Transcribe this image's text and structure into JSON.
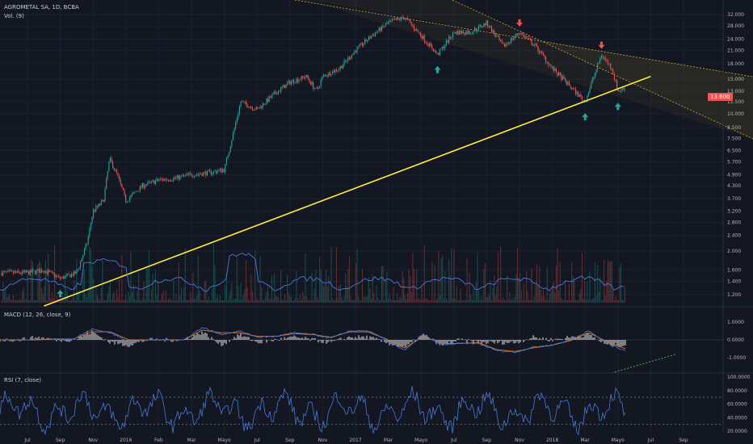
{
  "header": {
    "title": "AGROMETAL SA, 1D, BCBA",
    "volume_label": "Vol. (9)"
  },
  "panes": {
    "macd_label": "MACD (12, 26, close, 9)",
    "rsi_label": "RSI (7, close)"
  },
  "price_badge": "13.600",
  "colors": {
    "background": "#131722",
    "up": "#26a69a",
    "down": "#ef5350",
    "trendline": "#ffeb3b",
    "channel": "#c9b037",
    "indicator_blue": "#4a78d6",
    "indicator_orange": "#e0762a",
    "divergence": "#4caf50"
  },
  "chart_data": [
    {
      "type": "line",
      "name": "price",
      "scale": "log",
      "y_ticks": [
        "32.000",
        "28.000",
        "24.000",
        "21.000",
        "18.000",
        "15.000",
        "13.000",
        "11.500",
        "10.000",
        "8.500",
        "7.500",
        "6.500",
        "5.700",
        "4.900",
        "4.300",
        "3.700",
        "3.200",
        "2.800",
        "2.400",
        "2.000",
        "1.600",
        "1.400",
        "1.200"
      ],
      "x_ticks": [
        "Jul",
        "Sep",
        "Nov",
        "2016",
        "Feb",
        "Mar",
        "Mayo",
        "Jul",
        "Sep",
        "Nov",
        "2017",
        "Mar",
        "Mayo",
        "Jul",
        "Sep",
        "Nov",
        "2018",
        "Mar",
        "Mayo",
        "Jul",
        "Sep"
      ],
      "last_value": 13.6,
      "path": [
        {
          "x": "2015-07",
          "y": 1.55
        },
        {
          "x": "2015-08",
          "y": 1.6
        },
        {
          "x": "2015-09",
          "y": 1.45
        },
        {
          "x": "2015-10",
          "y": 1.55
        },
        {
          "x": "2015-10-20",
          "y": 2.2
        },
        {
          "x": "2015-11",
          "y": 3.2
        },
        {
          "x": "2015-11-20",
          "y": 3.6
        },
        {
          "x": "2015-12-01",
          "y": 5.9
        },
        {
          "x": "2015-12-15",
          "y": 4.9
        },
        {
          "x": "2016-01",
          "y": 3.6
        },
        {
          "x": "2016-02",
          "y": 4.3
        },
        {
          "x": "2016-03",
          "y": 4.6
        },
        {
          "x": "2016-04",
          "y": 4.7
        },
        {
          "x": "2016-05",
          "y": 4.9
        },
        {
          "x": "2016-06",
          "y": 5.0
        },
        {
          "x": "2016-07",
          "y": 5.2
        },
        {
          "x": "2016-07-15",
          "y": 7.5
        },
        {
          "x": "2016-08",
          "y": 11.5
        },
        {
          "x": "2016-09",
          "y": 10.5
        },
        {
          "x": "2016-10",
          "y": 12.5
        },
        {
          "x": "2016-11",
          "y": 14.5
        },
        {
          "x": "2016-12",
          "y": 15.5
        },
        {
          "x": "2016-12-20",
          "y": 13.0
        },
        {
          "x": "2017-01",
          "y": 15.5
        },
        {
          "x": "2017-02",
          "y": 17.0
        },
        {
          "x": "2017-03",
          "y": 21.0
        },
        {
          "x": "2017-04",
          "y": 25.0
        },
        {
          "x": "2017-05",
          "y": 29.0
        },
        {
          "x": "2017-06",
          "y": 31.0
        },
        {
          "x": "2017-07",
          "y": 25.0
        },
        {
          "x": "2017-08",
          "y": 20.0
        },
        {
          "x": "2017-09",
          "y": 26.0
        },
        {
          "x": "2017-10",
          "y": 26.0
        },
        {
          "x": "2017-11",
          "y": 29.0
        },
        {
          "x": "2017-12",
          "y": 22.0
        },
        {
          "x": "2018-01",
          "y": 26.0
        },
        {
          "x": "2018-02",
          "y": 22.0
        },
        {
          "x": "2018-03",
          "y": 17.0
        },
        {
          "x": "2018-04",
          "y": 14.0
        },
        {
          "x": "2018-05",
          "y": 11.5
        },
        {
          "x": "2018-05-15",
          "y": 15.0
        },
        {
          "x": "2018-06",
          "y": 20.0
        },
        {
          "x": "2018-06-20",
          "y": 17.0
        },
        {
          "x": "2018-07",
          "y": 13.0
        },
        {
          "x": "2018-07-15",
          "y": 13.6
        }
      ],
      "annotations": [
        {
          "type": "trendline",
          "from": {
            "x": "2015-08",
            "y": 1.05
          },
          "to": {
            "x": "2018-09",
            "y": 15.5
          }
        },
        {
          "type": "descending-channel"
        },
        {
          "type": "arrow-up",
          "x": "2015-09"
        },
        {
          "type": "arrow-up",
          "x": "2017-08"
        },
        {
          "type": "arrow-down",
          "x": "2018-01"
        },
        {
          "type": "arrow-up",
          "x": "2018-05"
        },
        {
          "type": "arrow-down",
          "x": "2018-06"
        },
        {
          "type": "arrow-up",
          "x": "2018-07"
        }
      ]
    },
    {
      "type": "line",
      "name": "MACD",
      "y_ticks": [
        "1.0000",
        "0.0000",
        "-1.0000"
      ],
      "macd": [
        0.0,
        0.0,
        0.05,
        0.05,
        0.05,
        0.6,
        0.4,
        -0.1,
        0.0,
        0.0,
        0.0,
        0.7,
        0.3,
        0.5,
        0.15,
        0.2,
        0.4,
        0.3,
        0.1,
        0.5,
        0.5,
        0.0,
        -0.6,
        0.3,
        -0.3,
        -0.2,
        -0.2,
        -0.6,
        -0.7,
        -0.4,
        -0.3,
        0.0,
        0.5,
        -0.2,
        -0.6
      ],
      "signal": [
        0.0,
        0.0,
        0.0,
        0.05,
        0.05,
        0.45,
        0.45,
        0.0,
        0.0,
        0.0,
        0.0,
        0.55,
        0.4,
        0.4,
        0.2,
        0.2,
        0.35,
        0.3,
        0.15,
        0.45,
        0.45,
        0.05,
        -0.45,
        0.2,
        -0.2,
        -0.2,
        -0.15,
        -0.55,
        -0.65,
        -0.45,
        -0.3,
        -0.05,
        0.4,
        -0.1,
        -0.5
      ]
    },
    {
      "type": "line",
      "name": "RSI",
      "y_ticks": [
        "100.0000",
        "80.0000",
        "60.0000",
        "40.0000",
        "20.0000"
      ],
      "bands": [
        70,
        30
      ]
    }
  ]
}
